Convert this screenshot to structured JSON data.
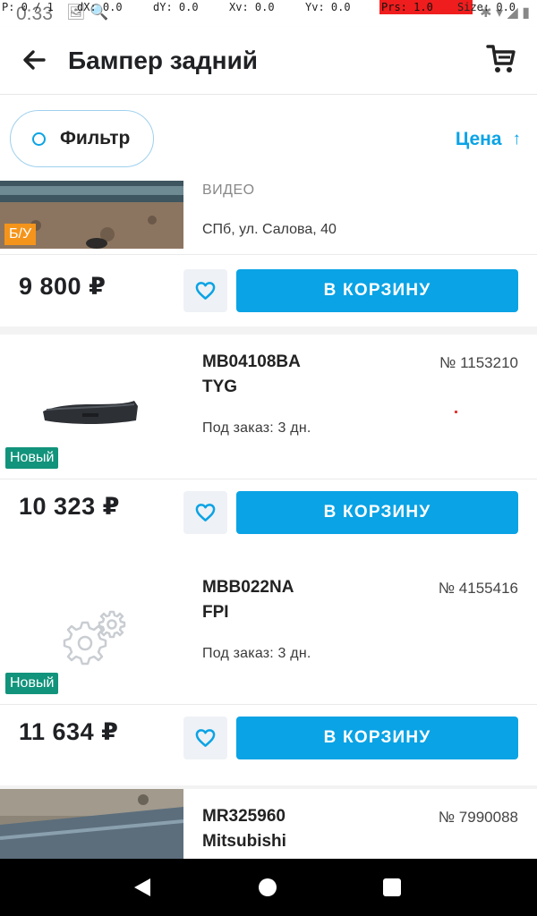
{
  "status_bar": {
    "time": "0:33",
    "debug": {
      "pointer": "P: 0 / 1",
      "dx": "dX: 0.0",
      "dy": "dY: 0.0",
      "xv": "Xv: 0.0",
      "yv": "Yv: 0.0",
      "prs": "Prs: 1.0",
      "size": "Size: 0.0"
    }
  },
  "header": {
    "title": "Бампер задний",
    "back_icon": "arrow-left-icon",
    "cart_icon": "shopping-cart-icon"
  },
  "filters": {
    "filter_label": "Фильтр",
    "sort_label": "Цена",
    "sort_direction": "ascending",
    "accent_color": "#0aa3e5"
  },
  "listings": [
    {
      "video_label": "ВИДЕО",
      "address": "СПб, ул. Салова, 40",
      "badge": "Б/У",
      "price": "9 800 ₽",
      "cart_button": "В КОРЗИНУ"
    },
    {
      "sku": "MB04108BA",
      "brand": "TYG",
      "number": "№ 1153210",
      "availability": "Под заказ: 3 дн.",
      "badge": "Новый",
      "price": "10 323 ₽",
      "cart_button": "В КОРЗИНУ"
    },
    {
      "sku": "MBB022NA",
      "brand": "FPI",
      "number": "№ 4155416",
      "availability": "Под заказ: 3 дн.",
      "badge": "Новый",
      "price": "11 634 ₽",
      "cart_button": "В КОРЗИНУ"
    },
    {
      "sku": "MR325960",
      "brand": "Mitsubishi",
      "number": "№ 7990088"
    }
  ],
  "colors": {
    "button_blue": "#0aa3e5",
    "badge_new": "#12937b",
    "badge_used": "#f5941b"
  }
}
